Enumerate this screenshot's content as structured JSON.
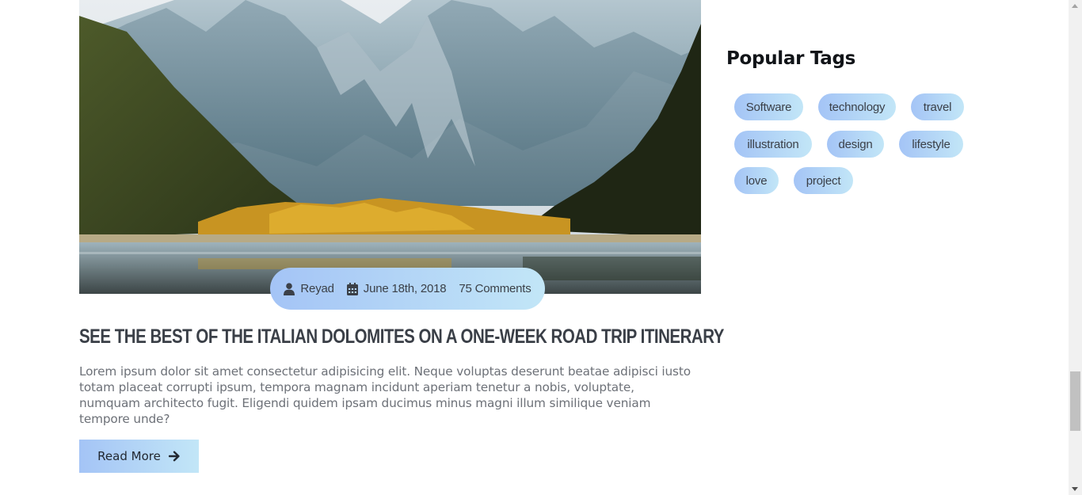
{
  "post": {
    "image_alt": "Mountain lake landscape",
    "meta": {
      "author": "Reyad",
      "date": "June 18th, 2018",
      "comments": "75 Comments",
      "author_icon": "user-icon",
      "date_icon": "calendar-icon"
    },
    "title": "See the best of the Italian Dolomites on a one-week road trip itinerary",
    "excerpt": "Lorem ipsum dolor sit amet consectetur adipisicing elit. Neque voluptas deserunt beatae adipisci iusto totam placeat corrupti ipsum, tempora magnam incidunt aperiam tenetur a nobis, voluptate, numquam architecto fugit. Eligendi quidem ipsam ducimus minus magni illum similique veniam tempore unde?",
    "read_more_label": "Read More",
    "read_more_icon": "arrow-right-icon"
  },
  "sidebar": {
    "tags_title": "Popular Tags",
    "tags": [
      "Software",
      "technology",
      "travel",
      "illustration",
      "design",
      "lifestyle",
      "love",
      "project"
    ]
  },
  "colors": {
    "accent_gradient_start": "#a4c4f6",
    "accent_gradient_end": "#c2e6f7",
    "title": "#3a3f47",
    "body_text": "#6d7178"
  }
}
